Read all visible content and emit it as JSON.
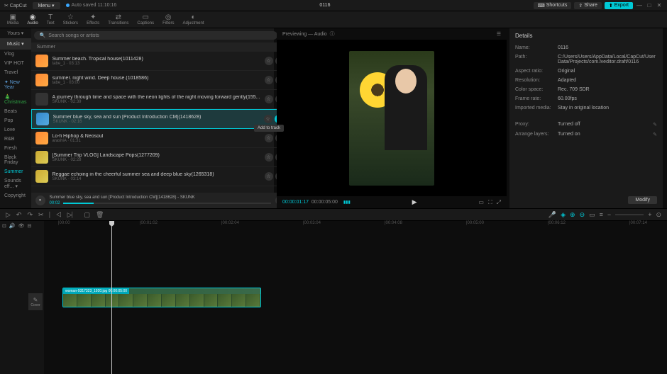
{
  "topbar": {
    "logo": "✂ CapCut",
    "menu": "Menu",
    "autosave": "Auto saved  11:10:16",
    "title": "0116",
    "shortcuts": "Shortcuts",
    "share": "Share",
    "export": "Export"
  },
  "tabs": [
    {
      "label": "Media",
      "icon": "▣"
    },
    {
      "label": "Audio",
      "icon": "◉"
    },
    {
      "label": "Text",
      "icon": "T"
    },
    {
      "label": "Stickers",
      "icon": "☆"
    },
    {
      "label": "Effects",
      "icon": "✦"
    },
    {
      "label": "Transitions",
      "icon": "⇄"
    },
    {
      "label": "Captions",
      "icon": "▭"
    },
    {
      "label": "Filters",
      "icon": "◎"
    },
    {
      "label": "Adjustment",
      "icon": "◐"
    }
  ],
  "cat_tabs": {
    "yours": "Yours",
    "music": "Music"
  },
  "categories": [
    {
      "label": "Vlog"
    },
    {
      "label": "VIP HOT"
    },
    {
      "label": "Travel"
    },
    {
      "label": "✦ New Year"
    },
    {
      "label": "🎄 Christmas"
    },
    {
      "label": "Beats"
    },
    {
      "label": "Pop"
    },
    {
      "label": "Love"
    },
    {
      "label": "R&B"
    },
    {
      "label": "Fresh"
    },
    {
      "label": "Black Friday"
    },
    {
      "label": "Summer"
    },
    {
      "label": "Sounds eff..."
    },
    {
      "label": "Copyright"
    }
  ],
  "search_placeholder": "Search songs or artists",
  "category_header": "Summer",
  "tracks": [
    {
      "title": "Summer beach. Tropical house(1011428)",
      "meta": "tabe_1 · 03:13"
    },
    {
      "title": "summer. night wind. Deep house.(1018586)",
      "meta": "tabe_1 · 03:00"
    },
    {
      "title": "A journey through time and space with the neon lights of the night moving forward gently(155...",
      "meta": "SKUNK · 02:39"
    },
    {
      "title": "Summer blue sky, sea and sun [Product Introduction CM](1418628)",
      "meta": "SKUNK · 02:16"
    },
    {
      "title": "Lo-fi Hiphop & Neosoul",
      "meta": "arashiA · 01:31"
    },
    {
      "title": "[Summer Trip VLOG] Landscape Pops(1277209)",
      "meta": "SKUNK · 02:28"
    },
    {
      "title": "Reggae echoing in the cheerful summer sea and deep blue sky(1265318)",
      "meta": "SKUNK · 03:14"
    }
  ],
  "tooltip": "Add to track",
  "now_playing": {
    "title": "Summer blue sky, sea and sun [Product Introduction CM](1418628) - SKUNK",
    "time": "00:02"
  },
  "preview": {
    "header": "Previewing — Audio",
    "current": "00:00:01:17",
    "total": "00:00:05:00"
  },
  "details": {
    "header": "Details",
    "rows": [
      {
        "label": "Name:",
        "value": "0116"
      },
      {
        "label": "Path:",
        "value": "C:/Users/Users/AppData/Local/CapCut/User Data/Projects/com.lveditor.draft/0116"
      },
      {
        "label": "Aspect ratio:",
        "value": "Original"
      },
      {
        "label": "Resolution:",
        "value": "Adapted"
      },
      {
        "label": "Color space:",
        "value": "Rec. 709 SDR"
      },
      {
        "label": "Frame rate:",
        "value": "60.00fps"
      },
      {
        "label": "Imported media:",
        "value": "Stay in original location"
      },
      {
        "label": "Proxy:",
        "value": "Turned off"
      },
      {
        "label": "Arrange layers:",
        "value": "Turned on"
      }
    ],
    "modify": "Modify"
  },
  "ruler": [
    "|00:00",
    "|00:01:02",
    "|00:02:04",
    "|00:03:04",
    "|00:04:08",
    "|00:05:00",
    "|00:06:12",
    "|00:07:14"
  ],
  "clip": {
    "label": "woman-9317323_1920.jpg  00:00:05:00"
  },
  "cover": "Cover"
}
